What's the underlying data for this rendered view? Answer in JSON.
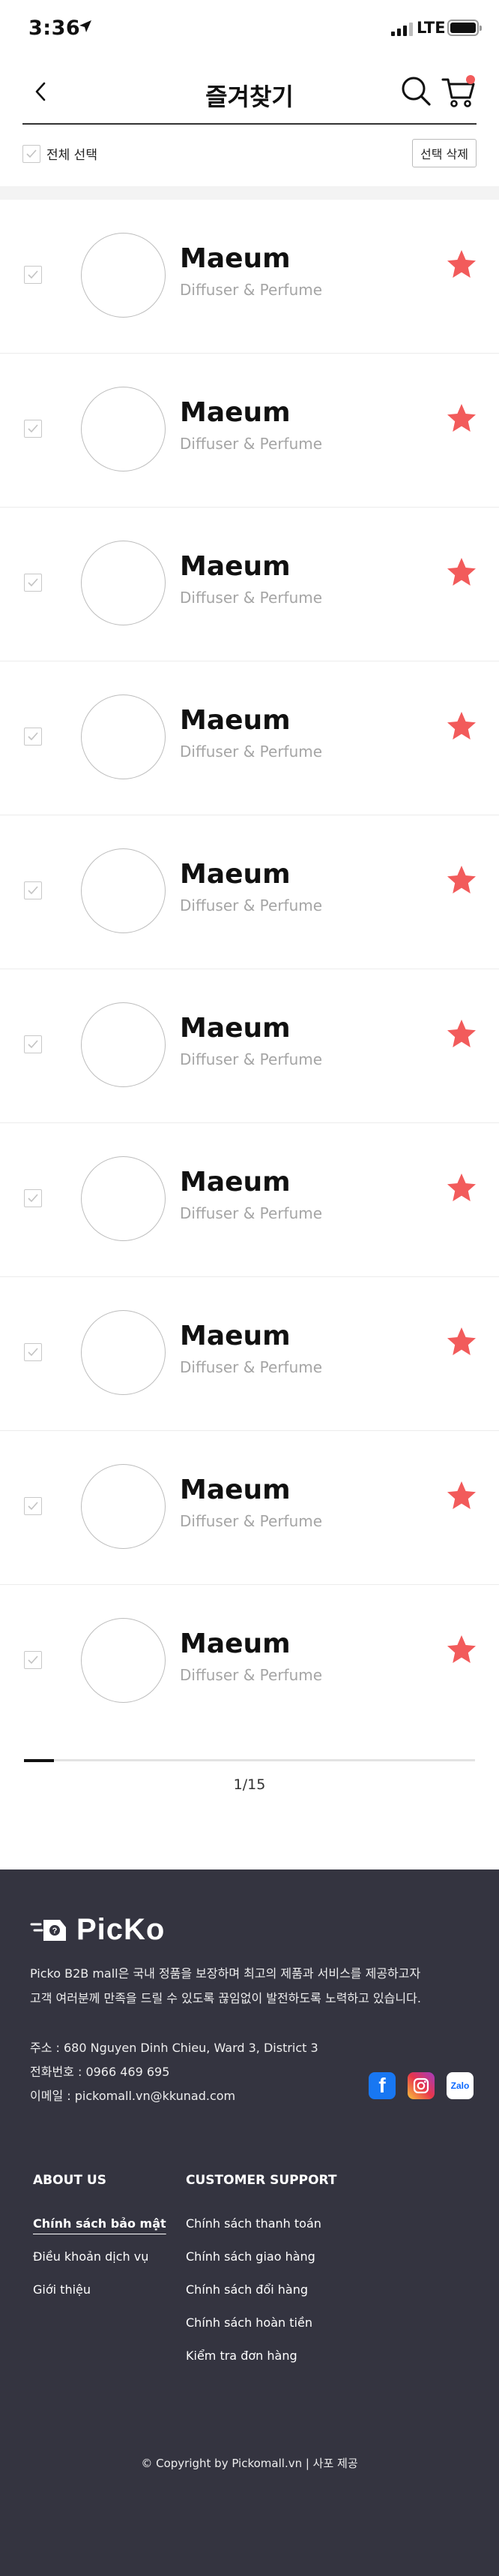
{
  "status_bar": {
    "time": "3:36",
    "network": "LTE"
  },
  "header": {
    "title": "즐겨찾기"
  },
  "select_bar": {
    "select_all_label": "전체 선택",
    "delete_label": "선택 삭제"
  },
  "favorites": [
    {
      "name": "Maeum",
      "category": "Diffuser & Perfume",
      "checked": true,
      "starred": true
    },
    {
      "name": "Maeum",
      "category": "Diffuser & Perfume",
      "checked": true,
      "starred": true
    },
    {
      "name": "Maeum",
      "category": "Diffuser & Perfume",
      "checked": true,
      "starred": true
    },
    {
      "name": "Maeum",
      "category": "Diffuser & Perfume",
      "checked": true,
      "starred": true
    },
    {
      "name": "Maeum",
      "category": "Diffuser & Perfume",
      "checked": true,
      "starred": true
    },
    {
      "name": "Maeum",
      "category": "Diffuser & Perfume",
      "checked": true,
      "starred": true
    },
    {
      "name": "Maeum",
      "category": "Diffuser & Perfume",
      "checked": true,
      "starred": true
    },
    {
      "name": "Maeum",
      "category": "Diffuser & Perfume",
      "checked": true,
      "starred": true
    },
    {
      "name": "Maeum",
      "category": "Diffuser & Perfume",
      "checked": true,
      "starred": true
    },
    {
      "name": "Maeum",
      "category": "Diffuser & Perfume",
      "checked": true,
      "starred": true
    }
  ],
  "pagination": {
    "text": "1/15",
    "current": 1,
    "total": 15
  },
  "footer": {
    "logo_text": "PicKo",
    "description_line1": "Picko B2B mall은 국내 정품을 보장하며 최고의 제품과 서비스를 제공하고자",
    "description_line2": "고객 여러분께 만족을 드릴 수 있도록 끊임없이 발전하도록 노력하고 있습니다.",
    "address": "주소 : 680 Nguyen Dinh Chieu, Ward 3, District 3",
    "phone": "전화번호 : 0966 469 695",
    "email": "이메일 : pickomall.vn@kkunad.com",
    "zalo_label": "Zalo",
    "about_title": "ABOUT US",
    "about_links": [
      "Chính sách bảo mật",
      "Điều khoản dịch vụ",
      "Giới thiệu"
    ],
    "support_title": "CUSTOMER SUPPORT",
    "support_links": [
      "Chính sách thanh toán",
      "Chính sách giao hàng",
      "Chính sách đổi hàng",
      "Chính sách hoàn tiền",
      "Kiểm tra đơn hàng"
    ],
    "copyright": "© Copyright by Pickomall.vn | 사포 제공"
  },
  "colors": {
    "star": "#f25b5b",
    "footer_bg": "#343440",
    "accent_dot": "#f25b5b"
  }
}
